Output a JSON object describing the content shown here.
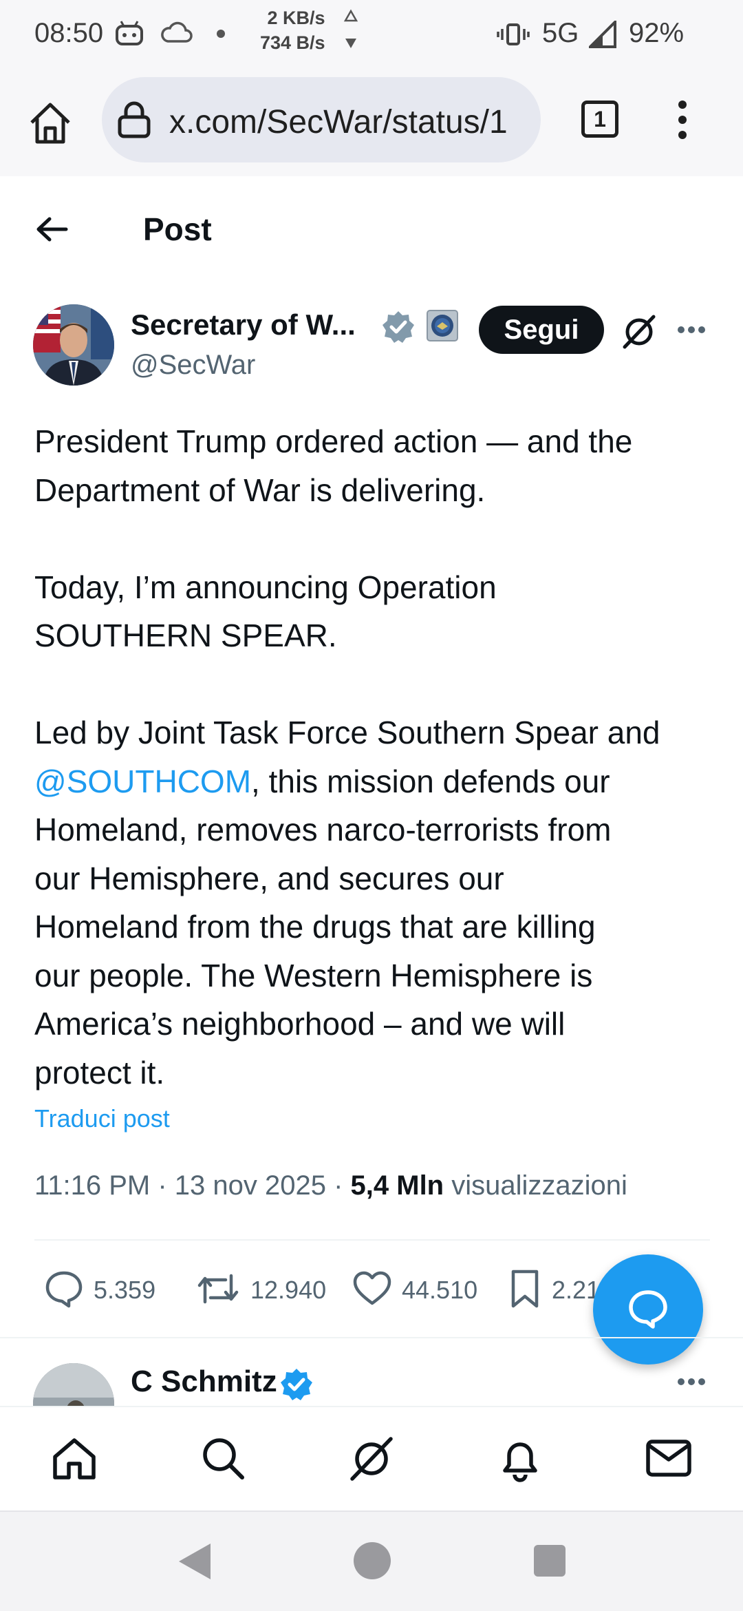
{
  "status_bar": {
    "time": "08:50",
    "upload_speed": "2 KB/s",
    "download_speed": "734 B/s",
    "network": "5G",
    "battery": "92%"
  },
  "browser": {
    "url": "x.com/SecWar/status/1",
    "tab_count": "1"
  },
  "header": {
    "title": "Post"
  },
  "author": {
    "name": "Secretary of W...",
    "handle": "@SecWar",
    "follow_label": "Segui"
  },
  "tweet": {
    "line1": "President Trump ordered action — and the",
    "line2": "Department of War is delivering.",
    "line3": "Today, I’m announcing Operation",
    "line4": "SOUTHERN SPEAR.",
    "line5": "Led by Joint Task Force Southern Spear and",
    "mention": "@SOUTHCOM",
    "line6_rest": ", this mission defends our",
    "line7": "Homeland, removes narco-terrorists from",
    "line8": "our Hemisphere, and secures our",
    "line9": "Homeland from the drugs that are killing",
    "line10": "our people. The Western Hemisphere is",
    "line11": "America’s neighborhood – and we will",
    "line12": "protect it.",
    "translate_label": "Traduci post",
    "timestamp": "11:16 PM · 13 nov 2025 · ",
    "views_count": "5,4 Mln",
    "views_label": " visualizzazioni"
  },
  "actions": {
    "replies": "5.359",
    "reposts": "12.940",
    "likes": "44.510",
    "bookmarks": "2.21"
  },
  "reply": {
    "name": "C Schmitz"
  },
  "colors": {
    "accent": "#1d9bf0",
    "text": "#0f1419",
    "secondary": "#536471"
  }
}
